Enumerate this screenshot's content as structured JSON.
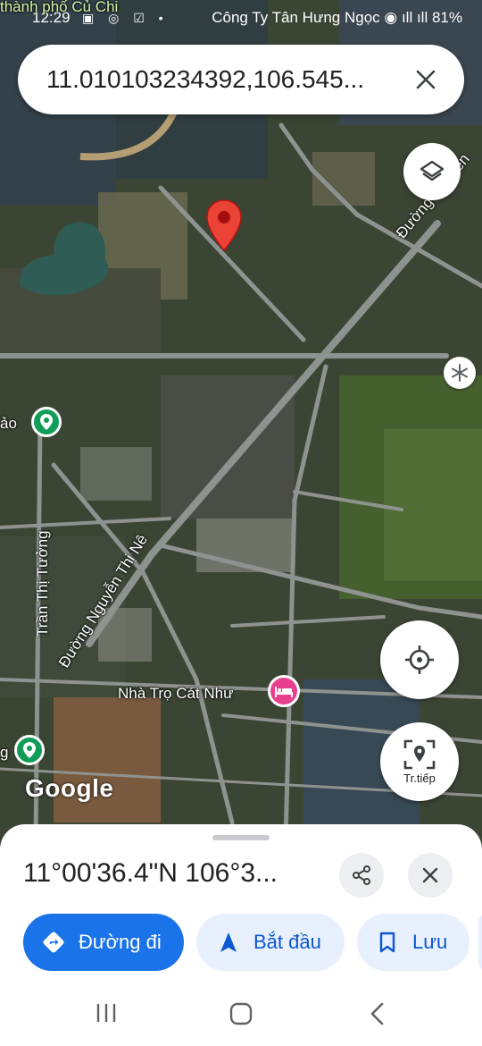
{
  "status_bar": {
    "time": "12:29",
    "carrier": "Công Ty Tân Hưng Ngọc",
    "battery": "81%"
  },
  "search": {
    "query": "11.010103234392,106.545..."
  },
  "map": {
    "labels": {
      "top_left": "thành phố Củ Chi",
      "road_ne": "Đường Nguyễn",
      "road_nguyen_thi_ne": "Đường Nguyễn Thị Nê",
      "road_tran_thi_tuong": "Trần Thị Tưởng",
      "left_edge": "ảo",
      "hotel": "Nhà Trọ Cát Như",
      "bottom_left": "g"
    },
    "attribution": "Google"
  },
  "controls": {
    "navigate_label": "Tr.tiếp"
  },
  "place_sheet": {
    "coordinates": "11°00'36.4\"N 106°3...",
    "actions": [
      {
        "label": "Đường đi"
      },
      {
        "label": "Bắt đầu"
      },
      {
        "label": "Lưu"
      }
    ]
  },
  "colors": {
    "pin": "#ea4335",
    "primary": "#1a73e8",
    "chip_bg": "#e8f0fe",
    "hotel": "#e8408f",
    "poi_green": "#0f9d58"
  }
}
